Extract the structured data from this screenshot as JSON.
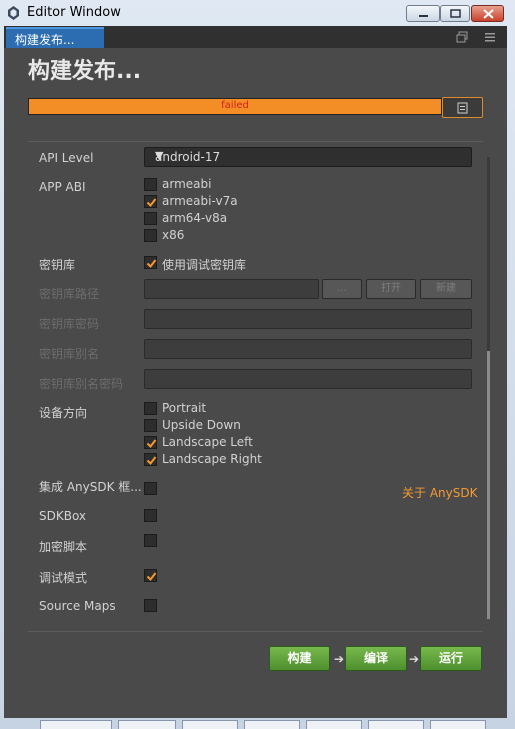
{
  "window": {
    "title": "Editor Window",
    "controls": {
      "minimize_icon": "minimize-icon",
      "maximize_icon": "maximize-icon",
      "close_icon": "close-icon"
    }
  },
  "tab": {
    "label": "构建发布...",
    "icons": [
      "restore-icon",
      "menu-icon"
    ]
  },
  "page": {
    "heading": "构建发布...",
    "progress": {
      "value": 1.0,
      "status": "failed",
      "color": "#f38d25",
      "status_color": "#d42020"
    },
    "open_folder_icon": "open-folder-icon"
  },
  "form": {
    "api_level": {
      "label": "API Level",
      "value": "android-17",
      "arrow": "▼"
    },
    "app_abi": {
      "label": "APP ABI",
      "options": [
        {
          "label": "armeabi",
          "checked": false
        },
        {
          "label": "armeabi-v7a",
          "checked": true
        },
        {
          "label": "arm64-v8a",
          "checked": false
        },
        {
          "label": "x86",
          "checked": false
        }
      ]
    },
    "keystore": {
      "label": "密钥库",
      "option_label": "使用调试密钥库",
      "checked": true
    },
    "keystore_path": {
      "label": "密钥库路径",
      "value": "",
      "buttons": [
        "...",
        "打开",
        "新建"
      ]
    },
    "keystore_password": {
      "label": "密钥库密码",
      "value": ""
    },
    "keystore_alias": {
      "label": "密钥库别名",
      "value": ""
    },
    "alias_password": {
      "label": "密钥库别名密码",
      "value": ""
    },
    "orientation": {
      "label": "设备方向",
      "options": [
        {
          "label": "Portrait",
          "checked": false
        },
        {
          "label": "Upside Down",
          "checked": false
        },
        {
          "label": "Landscape Left",
          "checked": true
        },
        {
          "label": "Landscape Right",
          "checked": true
        }
      ]
    },
    "anysdk": {
      "label": "集成 AnySDK 框...",
      "checked": false,
      "link": "关于 AnySDK"
    },
    "sdkbox": {
      "label": "SDKBox",
      "checked": false
    },
    "encrypt": {
      "label": "加密脚本",
      "checked": false
    },
    "debug": {
      "label": "调试模式",
      "checked": true
    },
    "source_maps": {
      "label": "Source Maps",
      "checked": false
    }
  },
  "actions": {
    "build": "构建",
    "compile": "编译",
    "run": "运行",
    "arrow": "➔"
  },
  "colors": {
    "accent": "#f38d25",
    "panel": "#4a4a4a",
    "tab": "#2b6db0",
    "button": "#5fa33b",
    "link": "#f59a33"
  }
}
